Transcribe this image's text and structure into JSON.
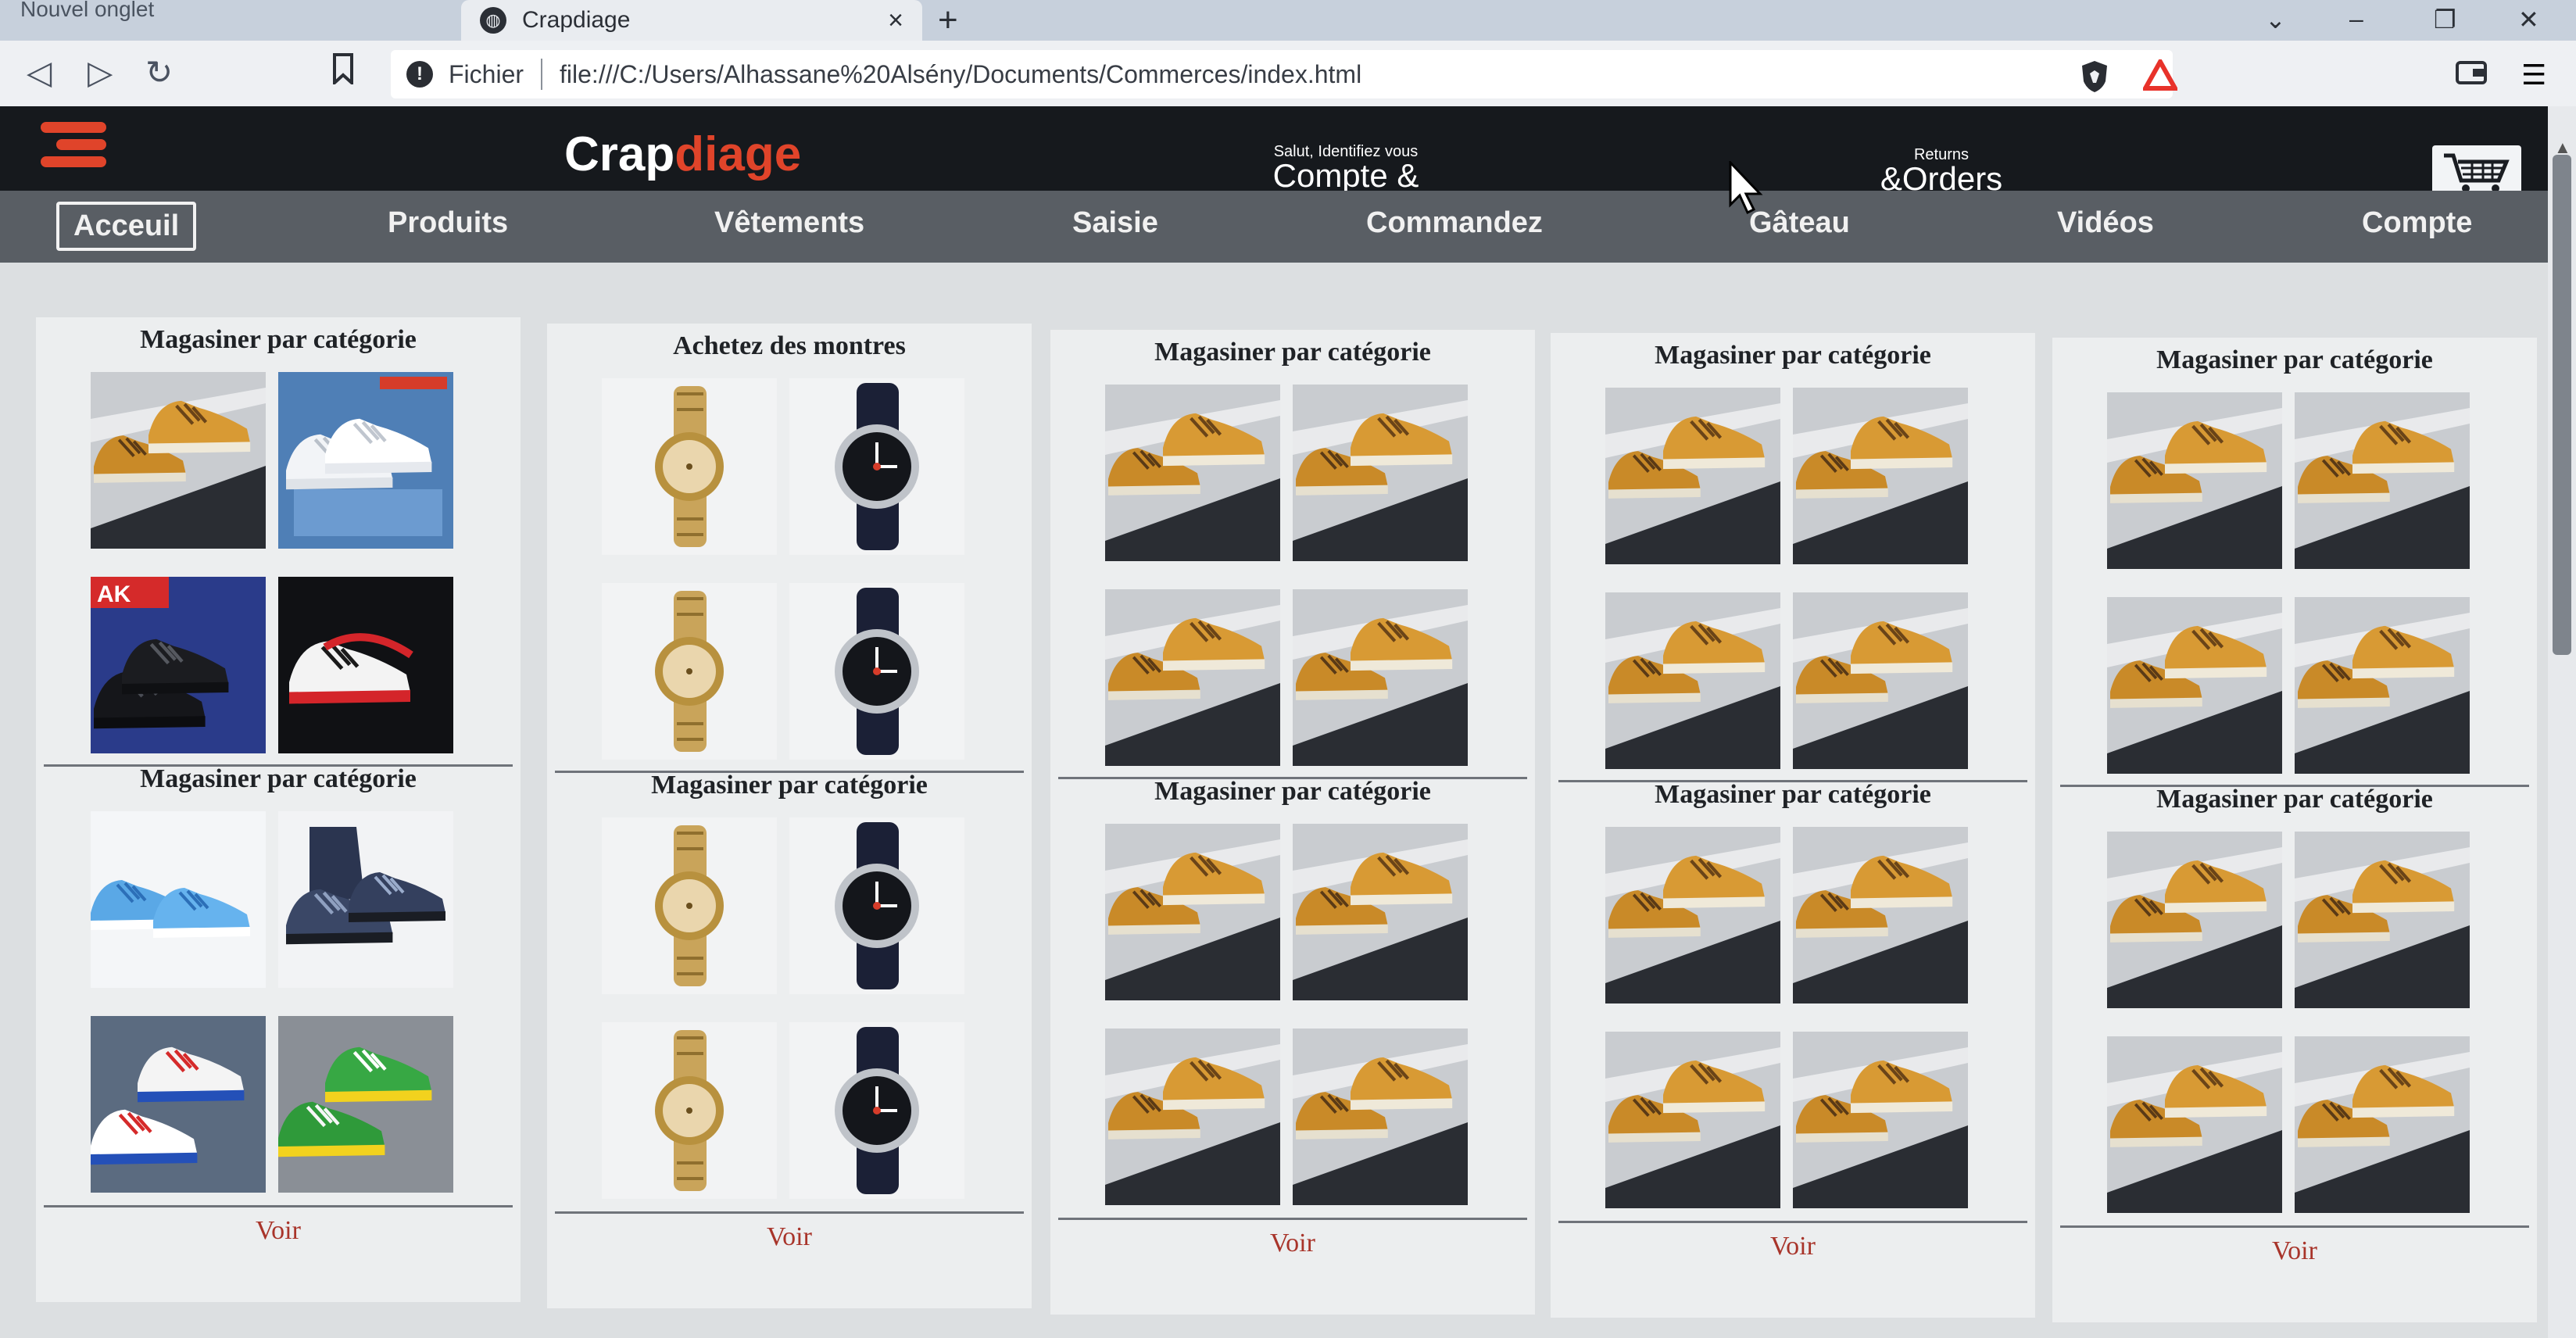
{
  "browser": {
    "inactive_tab": "Nouvel onglet",
    "active_tab": "Crapdiage",
    "close_tab": "×",
    "new_tab": "+",
    "url_label": "Fichier",
    "url": "file:///C:/Users/Alhassane%20Alsény/Documents/Commerces/index.html",
    "window_controls": [
      "⌄",
      "–",
      "❐",
      "✕"
    ]
  },
  "header": {
    "logo_part1": "Crap",
    "logo_part2": "diage",
    "account_small": "Salut, Identifiez vous",
    "account_big": "Compte & listes",
    "orders_small": "Returns",
    "orders_big": "&Orders"
  },
  "nav": [
    "Acceuil",
    "Produits",
    "Vêtements",
    "Saisie",
    "Commandez",
    "Gâteau",
    "Vidéos",
    "Compte"
  ],
  "cards": [
    {
      "sections": [
        {
          "title": "Magasiner par catégorie",
          "tiles": [
            "tan-sneakers",
            "white-sneakers-box",
            "black-boots-ak",
            "black-red-sneakers"
          ]
        },
        {
          "title": "Magasiner par catégorie",
          "tiles": [
            "blue-sneakers",
            "navy-high-top",
            "red-blue-sneakers",
            "green-yellow-sneakers"
          ]
        }
      ],
      "link": "Voir"
    },
    {
      "sections": [
        {
          "title": "Achetez des montres",
          "tiles": [
            "gold-watch",
            "black-watch",
            "gold-watch",
            "black-watch"
          ]
        },
        {
          "title": "Magasiner par catégorie",
          "tiles": [
            "gold-watch",
            "black-watch",
            "gold-watch",
            "black-watch"
          ]
        }
      ],
      "link": "Voir"
    },
    {
      "sections": [
        {
          "title": "Magasiner par catégorie",
          "tiles": [
            "tan-sneakers",
            "tan-sneakers",
            "tan-sneakers",
            "tan-sneakers"
          ]
        },
        {
          "title": "Magasiner par catégorie",
          "tiles": [
            "tan-sneakers",
            "tan-sneakers",
            "tan-sneakers",
            "tan-sneakers"
          ]
        }
      ],
      "link": "Voir"
    },
    {
      "sections": [
        {
          "title": "Magasiner par catégorie",
          "tiles": [
            "tan-sneakers",
            "tan-sneakers",
            "tan-sneakers",
            "tan-sneakers"
          ]
        },
        {
          "title": "Magasiner par catégorie",
          "tiles": [
            "tan-sneakers",
            "tan-sneakers",
            "tan-sneakers",
            "tan-sneakers"
          ]
        }
      ],
      "link": "Voir"
    },
    {
      "sections": [
        {
          "title": "Magasiner par catégorie",
          "tiles": [
            "tan-sneakers",
            "tan-sneakers",
            "tan-sneakers",
            "tan-sneakers"
          ]
        },
        {
          "title": "Magasiner par catégorie",
          "tiles": [
            "tan-sneakers",
            "tan-sneakers",
            "tan-sneakers",
            "tan-sneakers"
          ]
        }
      ],
      "link": "Voir"
    }
  ],
  "tile_text": {
    "ak": "AK"
  },
  "colors": {
    "brand_accent": "#e0442a",
    "header_bg": "#16191d",
    "nav_bg": "#595e64",
    "link": "#a8342a"
  }
}
